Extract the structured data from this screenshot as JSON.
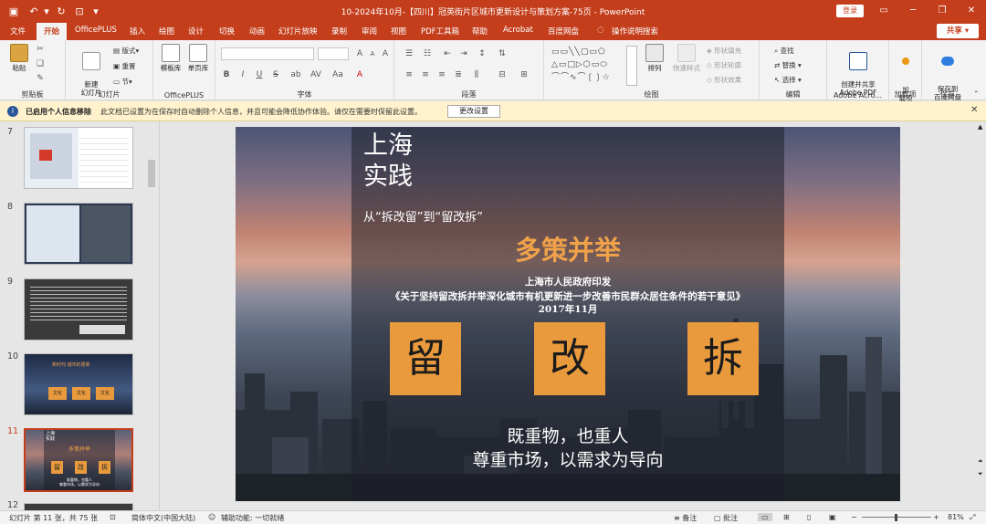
{
  "titlebar": {
    "doc_title": "10-2024年10月-【四川】冠英街片区城市更新设计与策划方案-75页 - PowerPoint",
    "login": "登录"
  },
  "tabs": [
    "文件",
    "开始",
    "OfficePLUS",
    "插入",
    "绘图",
    "设计",
    "切换",
    "动画",
    "幻灯片放映",
    "录制",
    "审阅",
    "视图",
    "PDF工具箱",
    "帮助",
    "Acrobat",
    "百度网盘",
    "操作说明搜索"
  ],
  "share": "共享",
  "ribbon": {
    "clipboard": {
      "paste": "粘贴",
      "label": "剪贴板"
    },
    "slides": {
      "new_slide": "新建\n幻灯片",
      "layout": "版式",
      "reset": "重置",
      "section": "节",
      "label": "幻灯片"
    },
    "officeplus": {
      "template": "模板库",
      "single": "单页库",
      "label": "OfficePLUS"
    },
    "font": {
      "label": "字体",
      "bold": "B",
      "italic": "I",
      "underline": "U",
      "strike": "S",
      "shadow": "ab",
      "spacing": "AV",
      "case": "Aa",
      "grow": "A",
      "shrink": "A",
      "clear": "A"
    },
    "paragraph": {
      "label": "段落"
    },
    "drawing": {
      "arrange": "排列",
      "quick_styles": "快速样式",
      "fill": "形状填充",
      "outline": "形状轮廓",
      "effect": "形状效果",
      "label": "绘图"
    },
    "editing": {
      "find": "查找",
      "replace": "替换",
      "select": "选择",
      "label": "编辑"
    },
    "adobe": {
      "create": "创建并共享\nAdobe PDF",
      "label": "Adobe Acro..."
    },
    "addins": {
      "btn": "加\n载项",
      "label": "加载项"
    },
    "save": {
      "btn": "保存到\n百度网盘",
      "label": "保存"
    }
  },
  "notice": {
    "bold": "已启用个人信息移除",
    "text": "此文档已设置为在保存时自动删除个人信息，并且可能会降低协作体验。请仅在需要时保留此设置。",
    "button": "更改设置"
  },
  "thumbnails": {
    "numbers": [
      "7",
      "8",
      "9",
      "10",
      "11",
      "12"
    ],
    "current": "11",
    "t10": {
      "title": "新时代·城市的更新",
      "words": [
        "文化",
        "文化",
        "文化"
      ]
    },
    "t11": {
      "title": "上海\n实践",
      "headline": "多策并举",
      "boxes": [
        "留",
        "改",
        "拆"
      ],
      "bottom": "既重物，也重人\n尊重市场，以需求为导向"
    }
  },
  "slide": {
    "title": "上海\n实践",
    "subtitle": "从“拆改留”到“留改拆”",
    "headline": "多策并举",
    "publisher": "上海市人民政府印发",
    "doc": "《关于坚持留改拆并举深化城市有机更新进一步改善市民群众居住条件的若干意见》",
    "date": "2017年11月",
    "boxes": [
      "留",
      "改",
      "拆"
    ],
    "bottom1": "既重物，也重人",
    "bottom2": "尊重市场，以需求为导向"
  },
  "status": {
    "slide_info": "幻灯片 第 11 张，共 75 张",
    "lang": "简体中文(中国大陆)",
    "access": "辅助功能: 一切就绪",
    "notes": "备注",
    "comments": "批注",
    "zoom": "81%"
  },
  "colors": {
    "accent": "#c43e1c",
    "box": "#e89a3d",
    "headline": "#f0a24a"
  }
}
